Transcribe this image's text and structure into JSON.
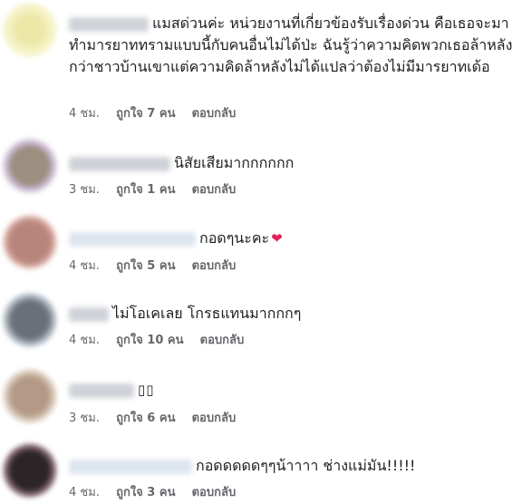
{
  "comments": [
    {
      "text": "แมสด่วนค่ะ หน่วยงานที่เกี่ยวข้องรับเรื่องด่วน คือเธอจะมาทำมารยาททรามแบบนี้กับคนอื่นไม่ได้ป่ะ ฉันรู้ว่าความคิดพวกเธอล้าหลังกว่าชาวบ้านเขาแต่ความคิดล้าหลังไม่ได้แปลว่าต้องไม่มีมารยาทเด้อ",
      "time": "4 ชม.",
      "like": "ถูกใจ 7 คน",
      "reply": "ตอบกลับ",
      "avatar_color": "#ece8a8"
    },
    {
      "text": "นิสัยเสียมากกกกกก",
      "time": "3 ชม.",
      "like": "ถูกใจ 1 คน",
      "reply": "ตอบกลับ",
      "avatar_color": "#9c8f80"
    },
    {
      "text": "กอดๆนะคะ",
      "time": "4 ชม.",
      "like": "ถูกใจ 5 คน",
      "reply": "ตอบกลับ",
      "avatar_color": "#b7857c"
    },
    {
      "text": "ไม่โอเคเลย โกรธแทนมากกกๆ",
      "time": "4 ชม.",
      "like": "ถูกใจ 10 คน",
      "reply": "ตอบกลับ",
      "avatar_color": "#6b7078"
    },
    {
      "text": "▯▯",
      "time": "3 ชม.",
      "like": "ถูกใจ 6 คน",
      "reply": "ตอบกลับ",
      "avatar_color": "#b49a86"
    },
    {
      "text": "กอดดดดดๆๆน้าาาา ช่างแม่มัน!!!!!",
      "time": "4 ชม.",
      "like": "ถูกใจ 3 คน",
      "reply": "ตอบกลับ",
      "avatar_color": "#2b2528"
    }
  ],
  "colors": {
    "text": "#1c1e21",
    "meta": "#65676b",
    "heart": "#e0245e"
  }
}
